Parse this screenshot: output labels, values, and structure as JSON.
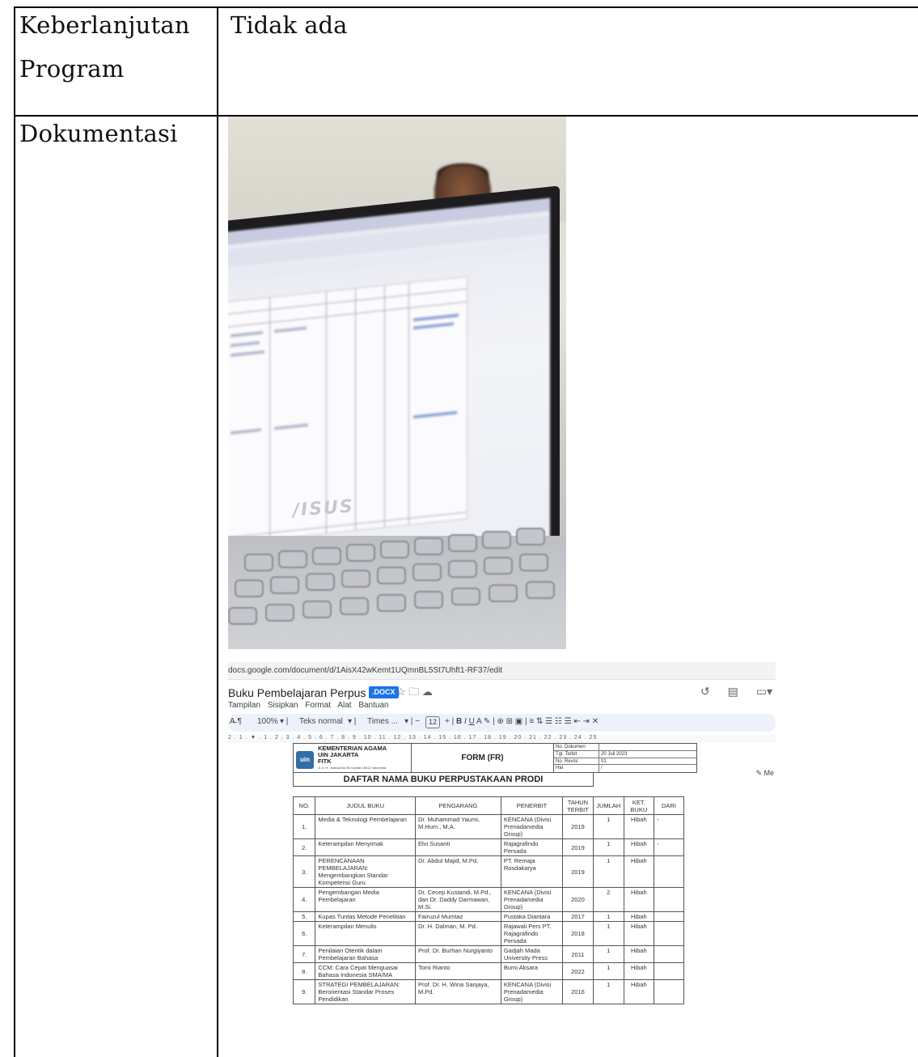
{
  "rows": [
    {
      "label_lines": [
        "Keberlanjutan",
        "Program"
      ],
      "value": "Tidak ada"
    },
    {
      "label_lines": [
        "Dokumentasi"
      ],
      "value": ""
    }
  ],
  "photo": {
    "brand_text": "/ISUS"
  },
  "gdoc": {
    "url": "docs.google.com/document/d/1AisX42wKemt1UQmnBL5St7Uhft1-RF37/edit",
    "doc_title": "Buku Pembelajaran Perpus Prodi",
    "badge": ".DOCX",
    "menu": [
      "Tampilan",
      "Sisipkan",
      "Format",
      "Alat",
      "Bantuan"
    ],
    "toolbar": {
      "zoom": "100%",
      "style": "Teks normal",
      "font": "Times ...",
      "font_size": "12",
      "edit_mode": "Me"
    },
    "ruler": "2 . 1 . ▼ . 1 . 2 . 3 . 4 . 5 . 6 . 7 . 8 . 9 . 10 . 11 . 12 . 13 . 14 . 15 . 16 . 17 . 18 . 19 . 20 . 21 . 22 . 23 . 24 . 25",
    "form_header": {
      "ministry": "KEMENTERIAN AGAMA",
      "university": "UIN JAKARTA",
      "faculty": "FITK",
      "address": "Jl. Ir. H. Juanda No.95 Ciputat 15412 Indonesia",
      "logo_text": "uin",
      "form_label": "FORM (FR)",
      "meta": [
        {
          "key": "No. Dokumen",
          "value": ""
        },
        {
          "key": "Tgl. Terbit",
          "value": "20 Juli 2023"
        },
        {
          "key": "No. Revisi",
          "value": "01"
        },
        {
          "key": "Hal",
          "value": "/"
        }
      ],
      "list_title": "DAFTAR NAMA BUKU PERPUSTAKAAN PRODI"
    },
    "table": {
      "headers": [
        "NO.",
        "JUDUL BUKU",
        "PENGARANG",
        "PENERBIT",
        "TAHUN TERBIT",
        "JUMLAH",
        "KET. BUKU",
        "DARI"
      ],
      "rows": [
        [
          "1.",
          "Media & Teknologi Pembelajaran",
          "Dr. Muhammad Yaumi, M.Hum., M.A.",
          "KENCANA (Divisi Prenadamedia Group)",
          "2019",
          "1",
          "Hibah",
          "-"
        ],
        [
          "2.",
          "Keterampilan Menyimak",
          "Elvi Susanti",
          "Rajagrafindo Persada",
          "2019",
          "1",
          "Hibah",
          "-"
        ],
        [
          "3.",
          "PERENCANAAN PEMBELAJARAN: Mengembangkan Standar Kompetensi Guru",
          "Dr. Abdul Majid, M.Pd.",
          "PT. Remaja Rosdakarya",
          "2019",
          "1",
          "Hibah",
          ""
        ],
        [
          "4.",
          "Pengembangan Media Pembelajaran",
          "Dr. Cecep Kustandi, M.Pd., dan Dr. Daddy Darmawan, M.Si.",
          "KENCANA (Divisi Prenadamedia Group)",
          "2020",
          "2",
          "Hibah",
          ""
        ],
        [
          "5.",
          "Kupas Tuntas Metode Penelitian",
          "Fairuzul Mumtaz",
          "Pustaka Diantara",
          "2017",
          "1",
          "Hibah",
          ""
        ],
        [
          "6.",
          "Keterampilan Menulis",
          "Dr. H. Dalman, M. Pd.",
          "Rajawali Pers PT. Rajagrafindo Persada",
          "2018",
          "1",
          "Hibah",
          ""
        ],
        [
          "7.",
          "Penilaian Otentik dalam Pembelajaran Bahasa",
          "Prof. Dr. Burhan Nurgiyanto",
          "Gadjah Mada University Press",
          "2011",
          "1",
          "Hibah",
          ""
        ],
        [
          "8.",
          "CCM: Cara Cepat Menguasai Bahasa Indonesia SMA/MA",
          "Tomi Rianto",
          "Bumi Aksara",
          "2022",
          "1",
          "Hibah",
          ""
        ],
        [
          "9.",
          "STRATEGI PEMBELAJARAN: Berorientasi Standar Proses Pendidikan",
          "Prof. Dr. H. Wina Sanjaya, M.Pd.",
          "KENCANA (Divisi Prenadamedia Group)",
          "2016",
          "1",
          "Hibah",
          ""
        ]
      ]
    }
  }
}
